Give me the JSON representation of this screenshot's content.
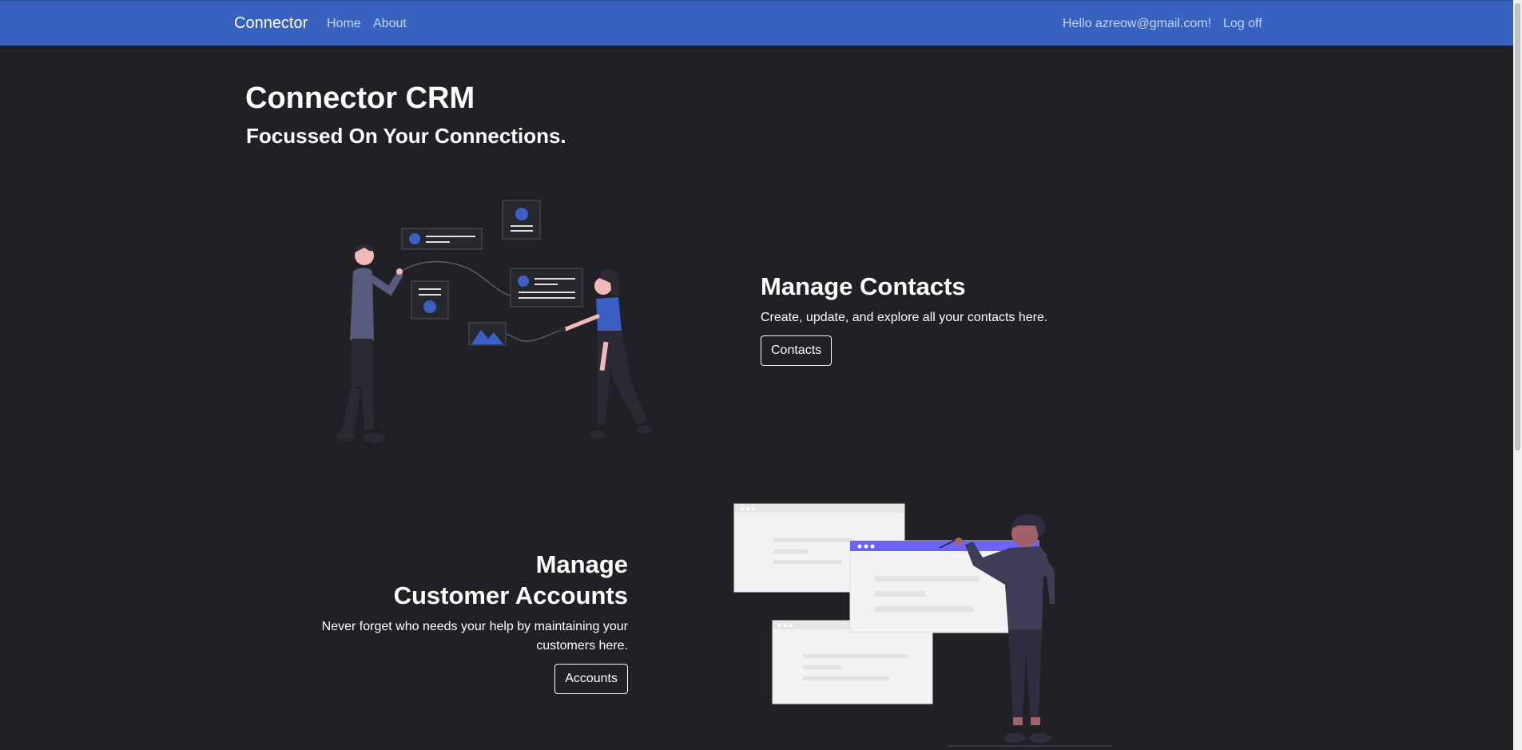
{
  "navbar": {
    "brand": "Connector",
    "links": [
      "Home",
      "About"
    ],
    "greeting": "Hello azreow@gmail.com!",
    "logoff": "Log off"
  },
  "hero": {
    "title": "Connector CRM",
    "subtitle": "Focussed On Your Connections."
  },
  "contacts_section": {
    "title": "Manage Contacts",
    "description": "Create, update, and explore all your contacts here.",
    "button": "Contacts"
  },
  "accounts_section": {
    "title_line1": "Manage",
    "title_line2": "Customer Accounts",
    "description_line1": "Never forget who needs your help by maintaining your",
    "description_line2": "customers here.",
    "button": "Accounts"
  },
  "colors": {
    "navbar": "#3762c0",
    "background": "#1f2125",
    "accent_blue": "#3b5fc4",
    "accent_purple": "#6c63ff"
  },
  "icons": [
    "connected-people-illustration",
    "presentation-illustration"
  ]
}
